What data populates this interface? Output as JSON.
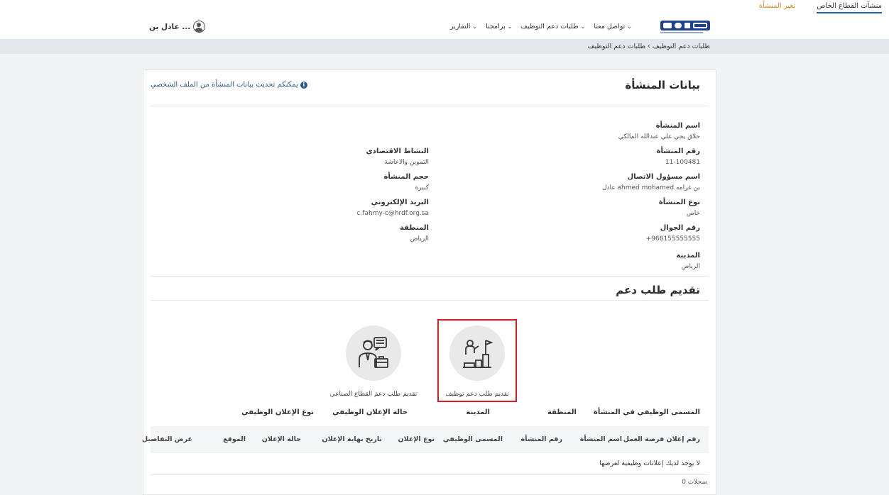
{
  "top": {
    "private_tab": "منشآت القطاع الخاص",
    "change_tab": "تغير المنشأة"
  },
  "nav": {
    "logo_text": "هدف",
    "logo_en": "HADAF",
    "items": [
      {
        "label": "تواصل معنا"
      },
      {
        "label": "طلبات دعم التوظيف"
      },
      {
        "label": "برامجنا"
      },
      {
        "label": "التقارير"
      }
    ],
    "user_name": "عادل بن ..."
  },
  "breadcrumb": "طلبات دعم التوظيف › طلبات دعم التوظيف",
  "facility": {
    "title": "بيانات المنشأة",
    "update_note": "يمكنكم تحديث بيانات المنشأة من الملف الشخصي",
    "name_label": "اسم المنشأة",
    "name_value": "حلاق يحي علي عبدالله المالكي",
    "right_fields": [
      {
        "label": "رقم المنشأة",
        "value": "11-100481"
      },
      {
        "label": "اسم مسؤول الاتصال",
        "value": "عادل ahmed mohamed بن غرامه"
      },
      {
        "label": "نوع المنشأة",
        "value": "خاص"
      },
      {
        "label": "رقم الجوال",
        "value": "+966155555555"
      },
      {
        "label": "المدينة",
        "value": "الرياض"
      }
    ],
    "left_fields": [
      {
        "label": "النشاط الاقتصادي",
        "value": "التموين والاعاشة"
      },
      {
        "label": "حجم المنشأة",
        "value": "كبيرة"
      },
      {
        "label": "البريد الإلكتروني",
        "value": "c.fahmy-c@hrdf.org.sa"
      },
      {
        "label": "المنطقة",
        "value": "الرياض"
      }
    ]
  },
  "support": {
    "title": "تقديم طلب دعم",
    "option_employment": "تقديم طلب دعم توظيف",
    "option_industrial": "تقديم طلب دعم القطاع الصناعي"
  },
  "filters": [
    "المسمى الوظيفي في المنشأة",
    "المنطقة",
    "المدينة",
    "حالة الإعلان الوظيفي",
    "نوع الإعلان الوظيفي"
  ],
  "table": {
    "columns": [
      "رقم إعلان فرصة العمل",
      "اسم المنشأة",
      "رقم المنشأة",
      "المسمى الوظيفي",
      "نوع الإعلان",
      "تاريخ نهاية الإعلان",
      "حالة الإعلان",
      "الموقع",
      "عرض التفاصيل"
    ],
    "empty_message": "لا يوجد لديك إعلانات وظيفية لعرضها",
    "records": "0 سجلات"
  },
  "colors": {
    "accent_blue": "#2a5a8a",
    "highlight_red": "#d62020",
    "orange": "#d88a1e"
  }
}
